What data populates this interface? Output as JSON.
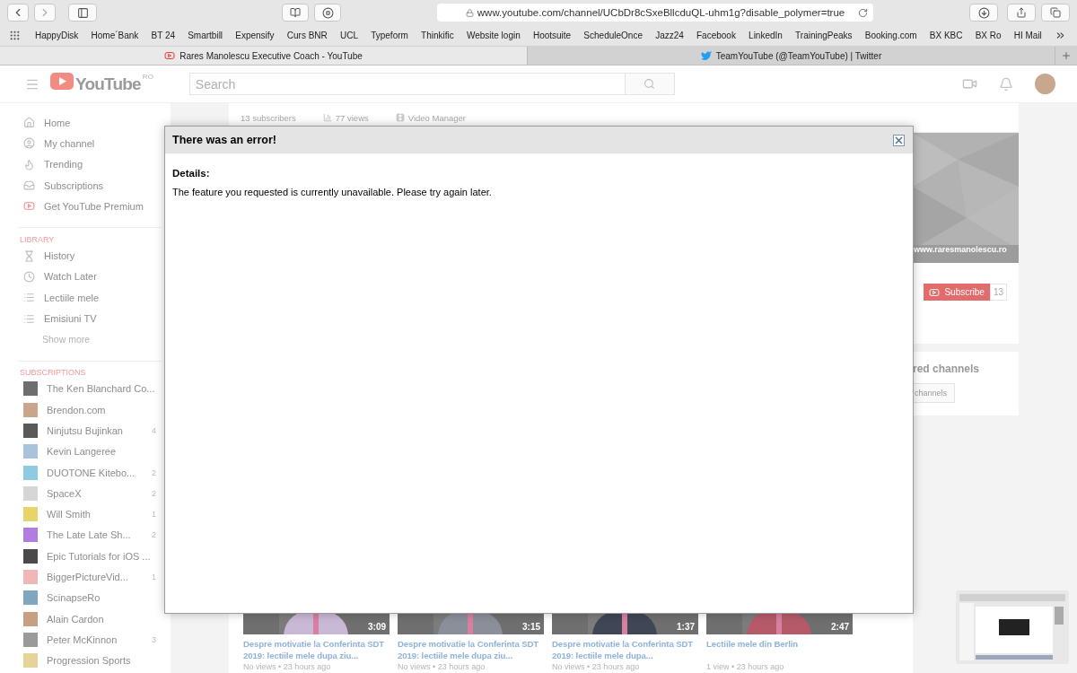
{
  "browser": {
    "url": "www.youtube.com/channel/UCbDr8cSxeBllcduQL-uhm1g?disable_polymer=true",
    "bookmarks": [
      "HappyDisk",
      "Home´Bank",
      "BT 24",
      "Smartbill",
      "Expensify",
      "Curs BNR",
      "UCL",
      "Typeform",
      "Thinkific",
      "Website login",
      "Hootsuite",
      "ScheduleOnce",
      "Jazz24",
      "Facebook",
      "LinkedIn",
      "TrainingPeaks",
      "Booking.com",
      "BX KBC",
      "BX Ro",
      "HI Mail"
    ],
    "tabs": [
      {
        "title": "Rares Manolescu Executive Coach - YouTube",
        "kind": "youtube",
        "selected": true
      },
      {
        "title": "TeamYouTube (@TeamYouTube) | Twitter",
        "kind": "twitter",
        "selected": false
      }
    ]
  },
  "header": {
    "logo": "YouTube",
    "region": "RO",
    "search": {
      "placeholder": "Search"
    }
  },
  "sidebar": {
    "main": [
      {
        "label": "Home"
      },
      {
        "label": "My channel"
      },
      {
        "label": "Trending"
      },
      {
        "label": "Subscriptions"
      },
      {
        "label": "Get YouTube Premium"
      }
    ],
    "library_heading": "LIBRARY",
    "library": [
      {
        "label": "History"
      },
      {
        "label": "Watch Later"
      },
      {
        "label": "Lectiile mele"
      },
      {
        "label": "Emisiuni TV"
      }
    ],
    "show_more": "Show more",
    "subscriptions_heading": "SUBSCRIPTIONS",
    "subscriptions": [
      {
        "name": "The Ken Blanchard Co...",
        "color": "#6e6e6e"
      },
      {
        "name": "Brendon.com",
        "color": "#c9a58e"
      },
      {
        "name": "Ninjutsu Bujinkan",
        "count": "4",
        "color": "#5a5a5a"
      },
      {
        "name": "Kevin Langeree",
        "color": "#a9c3dc"
      },
      {
        "name": "DUOTONE Kitebo...",
        "count": "2",
        "color": "#8ecbe0"
      },
      {
        "name": "SpaceX",
        "count": "2",
        "color": "#d6d6d6"
      },
      {
        "name": "Will Smith",
        "count": "1",
        "color": "#e8d46c"
      },
      {
        "name": "The Late Late Sh...",
        "count": "2",
        "color": "#b27de0"
      },
      {
        "name": "Epic Tutorials for iOS ...",
        "color": "#4a4a4a"
      },
      {
        "name": "BiggerPictureVid...",
        "count": "1",
        "color": "#f1b7b7"
      },
      {
        "name": "ScinapseRo",
        "color": "#7ea6bf"
      },
      {
        "name": "Alain Cardon",
        "color": "#c7a083"
      },
      {
        "name": "Peter McKinnon",
        "count": "3",
        "color": "#9a9a9a"
      },
      {
        "name": "Progression Sports",
        "color": "#e6d39a"
      }
    ]
  },
  "channel": {
    "stats": [
      "13 subscribers",
      "77 views",
      "Video Manager"
    ],
    "banner_link": "www.raresmanolescu.ro",
    "subscribe": {
      "label": "Subscribe",
      "count": "13"
    },
    "featured": {
      "heading": "red channels",
      "button": "channels"
    },
    "videos": [
      {
        "duration": "3:09",
        "title": "Despre motivatie la Conferinta SDT 2019: lectiile mele dupa ziu...",
        "meta": "No views • 23 hours ago"
      },
      {
        "duration": "3:15",
        "title": "Despre motivatie la Conferinta SDT 2019: lectiile mele dupa ziu...",
        "meta": "No views • 23 hours ago"
      },
      {
        "duration": "1:37",
        "title": "Despre motivatie la Conferinta SDT 2019: lectiile mele dupa...",
        "meta": "No views • 23 hours ago"
      },
      {
        "duration": "2:47",
        "title": "Lectiile mele din Berlin",
        "meta": "1 view • 23 hours ago"
      }
    ]
  },
  "dialog": {
    "title": "There was an error!",
    "details_label": "Details:",
    "message": "The feature you requested is currently unavailable. Please try again later."
  }
}
